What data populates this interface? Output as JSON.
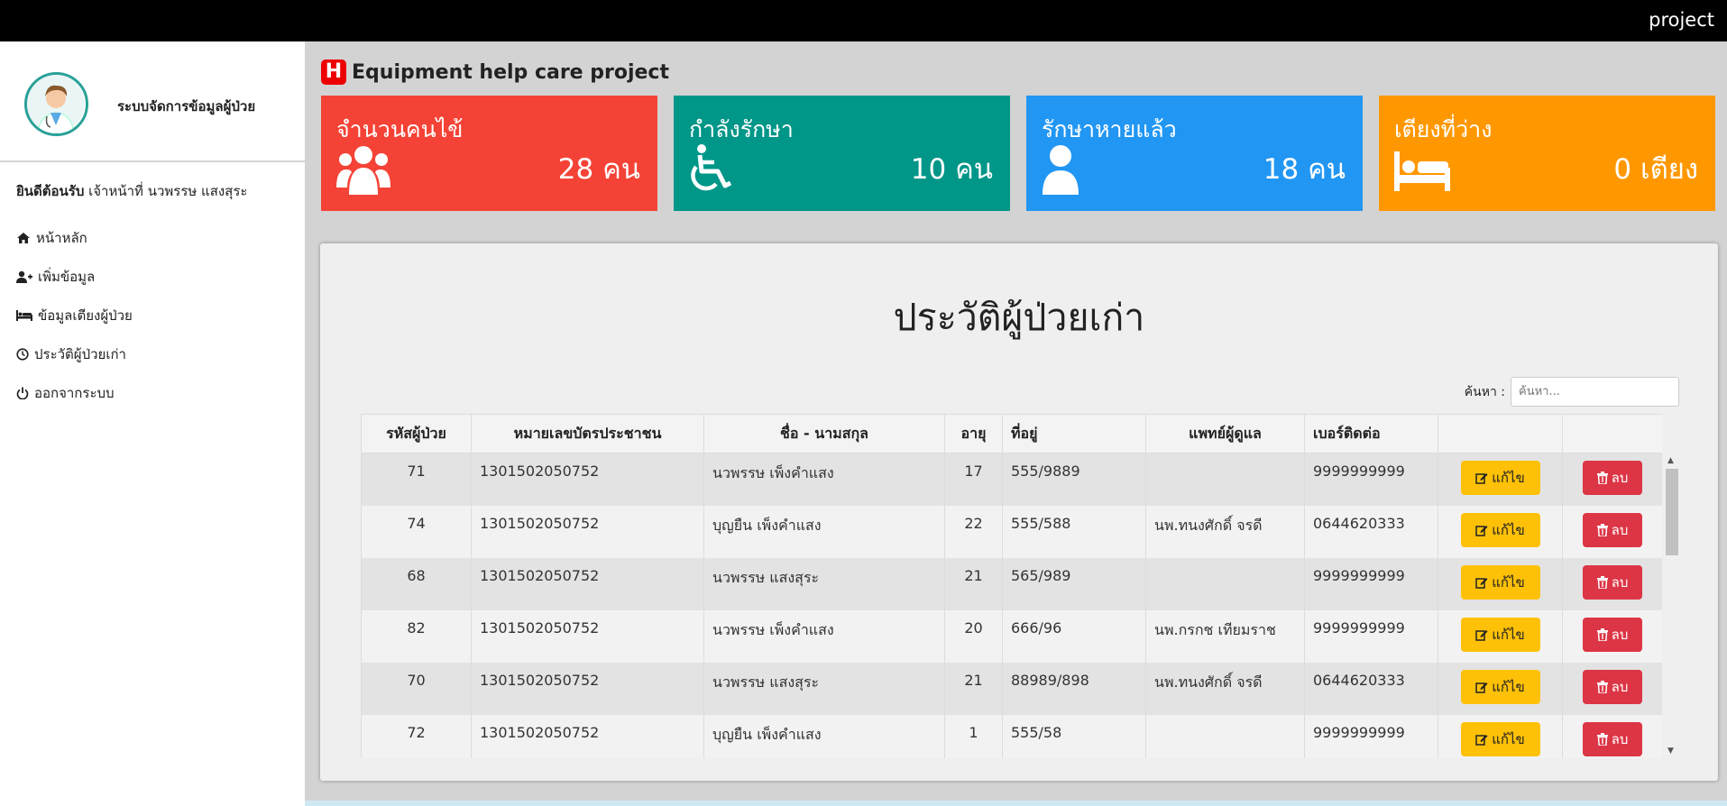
{
  "topbar": {
    "brand": "project"
  },
  "sidebar": {
    "system_title": "ระบบจัดการข้อมูลผู้ป่วย",
    "welcome_bold": "ยินดีต้อนรับ",
    "welcome_text": " เจ้าหน้าที่ นวพรรษ แสงสุระ",
    "menu": [
      {
        "label": "หน้าหลัก",
        "icon": "home-icon"
      },
      {
        "label": "เพิ่มข้อมูล",
        "icon": "user-plus-icon"
      },
      {
        "label": "ข้อมูลเตียงผู้ป่วย",
        "icon": "bed-icon"
      },
      {
        "label": "ประวัติผู้ป่วยเก่า",
        "icon": "clock-icon"
      },
      {
        "label": "ออกจากระบบ",
        "icon": "power-icon"
      }
    ]
  },
  "header": {
    "logo_letter": "H",
    "title": "Equipment help care project"
  },
  "cards": [
    {
      "title": "จำนวนคนไข้",
      "value": "28 คน",
      "color": "#f44336",
      "icon": "users-icon"
    },
    {
      "title": "กำลังรักษา",
      "value": "10 คน",
      "color": "#009688",
      "icon": "wheelchair-icon"
    },
    {
      "title": "รักษาหายแล้ว",
      "value": "18 คน",
      "color": "#2196f3",
      "icon": "user-icon"
    },
    {
      "title": "เตียงที่ว่าง",
      "value": "0 เตียง",
      "color": "#ff9800",
      "icon": "bed-icon"
    }
  ],
  "panel": {
    "heading": "ประวัติผู้ป่วยเก่า",
    "search_label": "ค้นหา :",
    "search_placeholder": "ค้นหา...",
    "columns": [
      "รหัสผู้ป่วย",
      "หมายเลขบัตรประชาชน",
      "ชื่อ - นามสกุล",
      "อายุ",
      "ที่อยู่",
      "แพทย์ผู้ดูแล",
      "เบอร์ติดต่อ",
      "",
      ""
    ],
    "edit_label": "แก้ไข",
    "delete_label": "ลบ",
    "rows": [
      {
        "id": "71",
        "citizen_id": "1301502050752",
        "name": "นวพรรษ เพ็งคำแสง",
        "age": "17",
        "address": "555/9889",
        "doctor": "",
        "phone": "9999999999"
      },
      {
        "id": "74",
        "citizen_id": "1301502050752",
        "name": "บุญยืน เพ็งคำแสง",
        "age": "22",
        "address": "555/588",
        "doctor": "นพ.ทนงศักดิ์ จรดี",
        "phone": "0644620333"
      },
      {
        "id": "68",
        "citizen_id": "1301502050752",
        "name": "นวพรรษ แสงสุระ",
        "age": "21",
        "address": "565/989",
        "doctor": "",
        "phone": "9999999999"
      },
      {
        "id": "82",
        "citizen_id": "1301502050752",
        "name": "นวพรรษ เพ็งคำแสง",
        "age": "20",
        "address": "666/96",
        "doctor": "นพ.กรกช เทียมราช",
        "phone": "9999999999"
      },
      {
        "id": "70",
        "citizen_id": "1301502050752",
        "name": "นวพรรษ แสงสุระ",
        "age": "21",
        "address": "88989/898",
        "doctor": "นพ.ทนงศักดิ์ จรดี",
        "phone": "0644620333"
      },
      {
        "id": "72",
        "citizen_id": "1301502050752",
        "name": "บุญยืน เพ็งคำแสง",
        "age": "1",
        "address": "555/58",
        "doctor": "",
        "phone": "9999999999"
      }
    ]
  }
}
